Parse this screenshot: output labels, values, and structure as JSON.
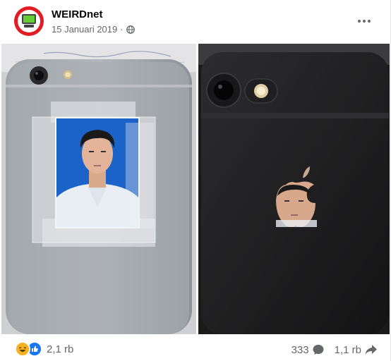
{
  "post": {
    "page_name": "WEIRDnet",
    "date": "15 Januari 2019",
    "separator": "·",
    "privacy_icon": "globe-icon"
  },
  "photos": [
    {
      "name": "left-photo",
      "description_icon": "photo"
    },
    {
      "name": "right-photo",
      "description_icon": "photo"
    }
  ],
  "footer": {
    "reaction_icons": [
      "haha-icon",
      "like-icon"
    ],
    "reaction_count": "2,1 rb",
    "comment_count": "333",
    "share_count": "1,1 rb"
  },
  "colors": {
    "brand_red": "#e31b23",
    "secondary_text": "#65676b",
    "like_blue": "#1877f2",
    "haha_yellow": "#f7b125"
  }
}
